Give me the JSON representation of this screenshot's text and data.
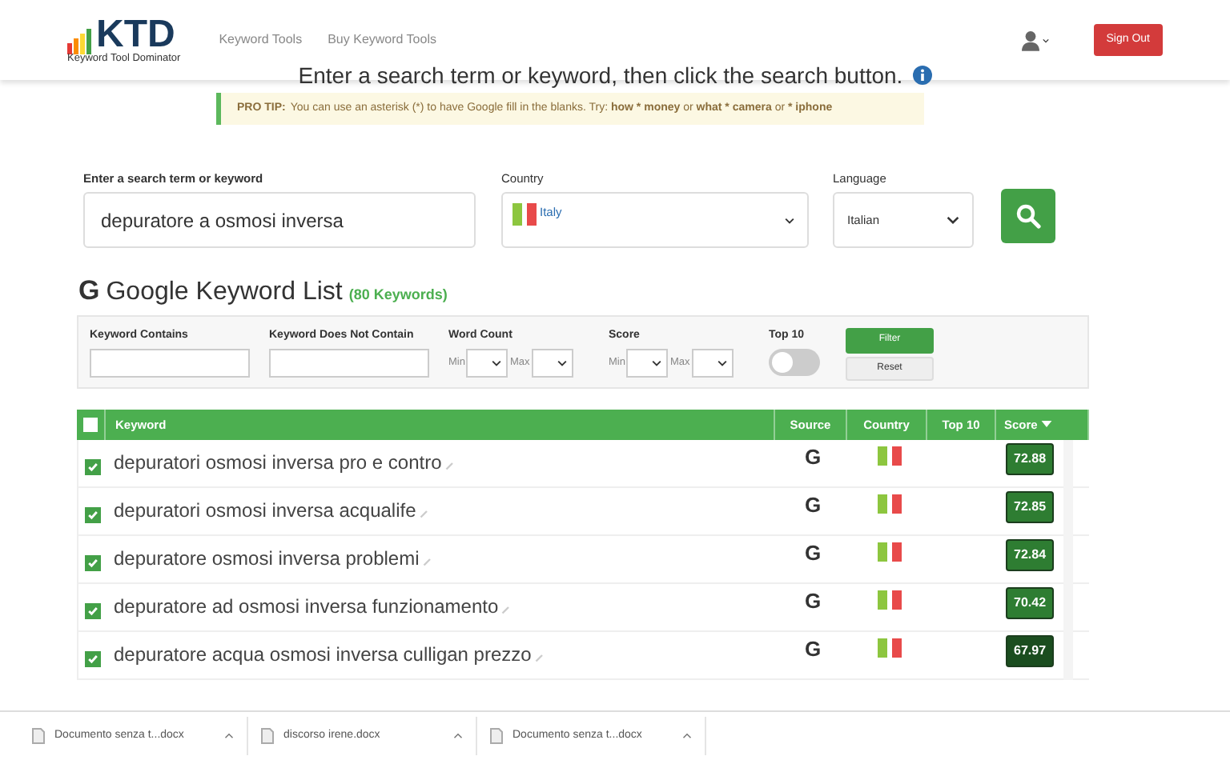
{
  "header": {
    "logo": "KTD",
    "logo_subtitle": "Keyword Tool Dominator",
    "nav": [
      "Keyword Tools",
      "Buy Keyword Tools"
    ],
    "sign_out": "Sign Out"
  },
  "heading": "Enter a search term or keyword, then click the search button.",
  "pro_tip": {
    "label": "PRO TIP:",
    "text": "You can use an asterisk (*) to have Google fill in the blanks. Try: **how * money** or **what * camera** or *** iphone**"
  },
  "search": {
    "keyword_label": "Enter a search term or keyword",
    "keyword_value": "depuratore a osmosi inversa",
    "country_label": "Country",
    "country_value": "Italy",
    "language_label": "Language",
    "language_value": "Italian"
  },
  "list": {
    "icon": "G",
    "title": "Google Keyword List",
    "count": "(80 Keywords)"
  },
  "filters": {
    "contains_label": "Keyword Contains",
    "not_contains_label": "Keyword Does Not Contain",
    "word_count_label": "Word Count",
    "word_count_min": "Min",
    "word_count_max": "Max",
    "score_label": "Score",
    "score_min": "Min",
    "score_max": "Max",
    "top10_label": "Top 10",
    "top10_on": false,
    "filter_button": "Filter",
    "reset_button": "Reset"
  },
  "table": {
    "all_checked": false,
    "columns": [
      "Keyword",
      "Source",
      "Country",
      "Top 10",
      "Score"
    ],
    "rows": [
      {
        "checked": true,
        "keyword": "depuratori osmosi inversa pro e contro",
        "source": "G",
        "score": "72.88",
        "color": "#2e7d32"
      },
      {
        "checked": true,
        "keyword": "depuratori osmosi inversa acqualife",
        "source": "G",
        "score": "72.85",
        "color": "#2e7d32"
      },
      {
        "checked": true,
        "keyword": "depuratore osmosi inversa problemi",
        "source": "G",
        "score": "72.84",
        "color": "#2e7d32"
      },
      {
        "checked": true,
        "keyword": "depuratore ad osmosi inversa funzionamento",
        "source": "G",
        "score": "70.42",
        "color": "#2e7d32"
      },
      {
        "checked": true,
        "keyword": "depuratore acqua osmosi inversa culligan prezzo",
        "source": "G",
        "score": "67.97",
        "color": "#1b4d1f"
      }
    ]
  },
  "downloads": [
    "Documento senza t...docx",
    "discorso irene.docx",
    "Documento senza t...docx"
  ]
}
